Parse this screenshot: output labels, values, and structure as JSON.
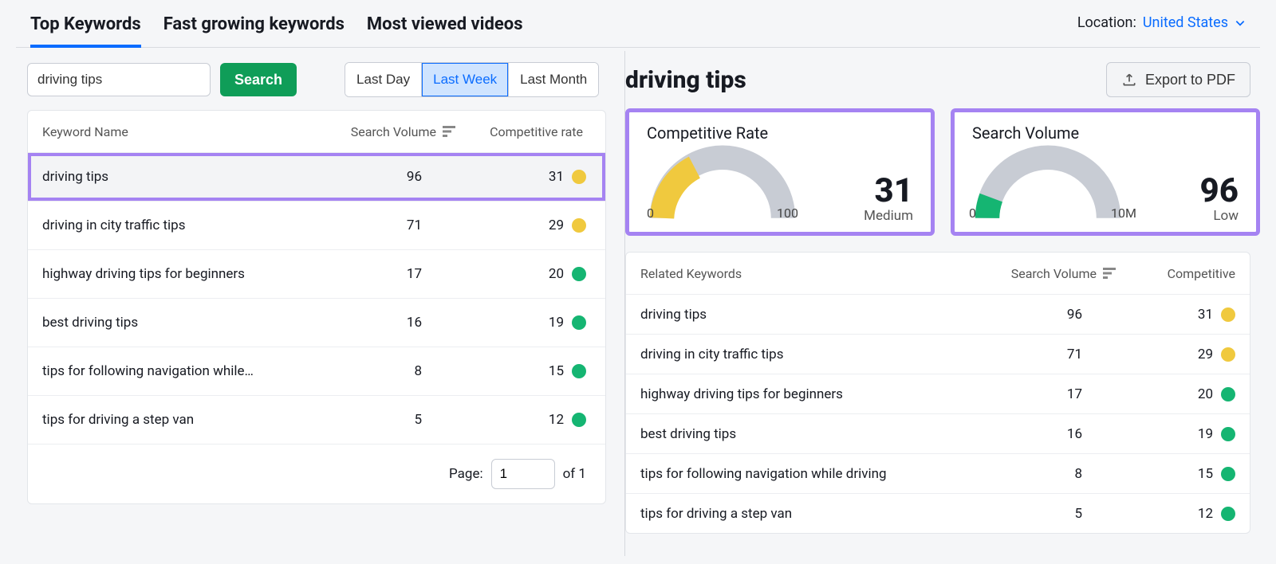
{
  "tabs": {
    "items": [
      "Top Keywords",
      "Fast growing keywords",
      "Most viewed videos"
    ],
    "active": 0
  },
  "location": {
    "label": "Location:",
    "value": "United States"
  },
  "search": {
    "value": "driving tips",
    "button": "Search"
  },
  "range": {
    "items": [
      "Last Day",
      "Last Week",
      "Last Month"
    ],
    "active": 1
  },
  "table": {
    "headers": {
      "name": "Keyword Name",
      "volume": "Search Volume",
      "rate": "Competitive rate"
    },
    "rows": [
      {
        "name": "driving tips",
        "volume": 96,
        "rate": 31,
        "color": "yellow",
        "highlight": true
      },
      {
        "name": "driving in city traffic tips",
        "volume": 71,
        "rate": 29,
        "color": "yellow"
      },
      {
        "name": "highway driving tips for beginners",
        "volume": 17,
        "rate": 20,
        "color": "green"
      },
      {
        "name": "best driving tips",
        "volume": 16,
        "rate": 19,
        "color": "green"
      },
      {
        "name": "tips for following navigation while…",
        "volume": 8,
        "rate": 15,
        "color": "green"
      },
      {
        "name": "tips for driving a step van",
        "volume": 5,
        "rate": 12,
        "color": "green"
      }
    ],
    "pager": {
      "label": "Page:",
      "value": "1",
      "of": "of 1"
    }
  },
  "detail": {
    "title": "driving tips",
    "export": "Export to PDF",
    "gauges": {
      "competitive": {
        "title": "Competitive Rate",
        "min": "0",
        "max": "100",
        "value": "31",
        "label": "Medium"
      },
      "volume": {
        "title": "Search Volume",
        "min": "0",
        "max": "10M",
        "value": "96",
        "label": "Low"
      }
    },
    "related": {
      "headers": {
        "name": "Related Keywords",
        "volume": "Search Volume",
        "rate": "Competitive"
      },
      "rows": [
        {
          "name": "driving tips",
          "volume": 96,
          "rate": 31,
          "color": "yellow"
        },
        {
          "name": "driving in city traffic tips",
          "volume": 71,
          "rate": 29,
          "color": "yellow"
        },
        {
          "name": "highway driving tips for beginners",
          "volume": 17,
          "rate": 20,
          "color": "green"
        },
        {
          "name": "best driving tips",
          "volume": 16,
          "rate": 19,
          "color": "green"
        },
        {
          "name": "tips for following navigation while driving",
          "volume": 8,
          "rate": 15,
          "color": "green"
        },
        {
          "name": "tips for driving a step van",
          "volume": 5,
          "rate": 12,
          "color": "green"
        }
      ]
    }
  },
  "chart_data": [
    {
      "type": "gauge",
      "title": "Competitive Rate",
      "min": 0,
      "max": 100,
      "value": 31,
      "label": "Medium",
      "color": "#f0c93e"
    },
    {
      "type": "gauge",
      "title": "Search Volume",
      "min": 0,
      "max": 10000000,
      "max_label": "10M",
      "value": 96,
      "label": "Low",
      "color": "#15b572"
    }
  ]
}
